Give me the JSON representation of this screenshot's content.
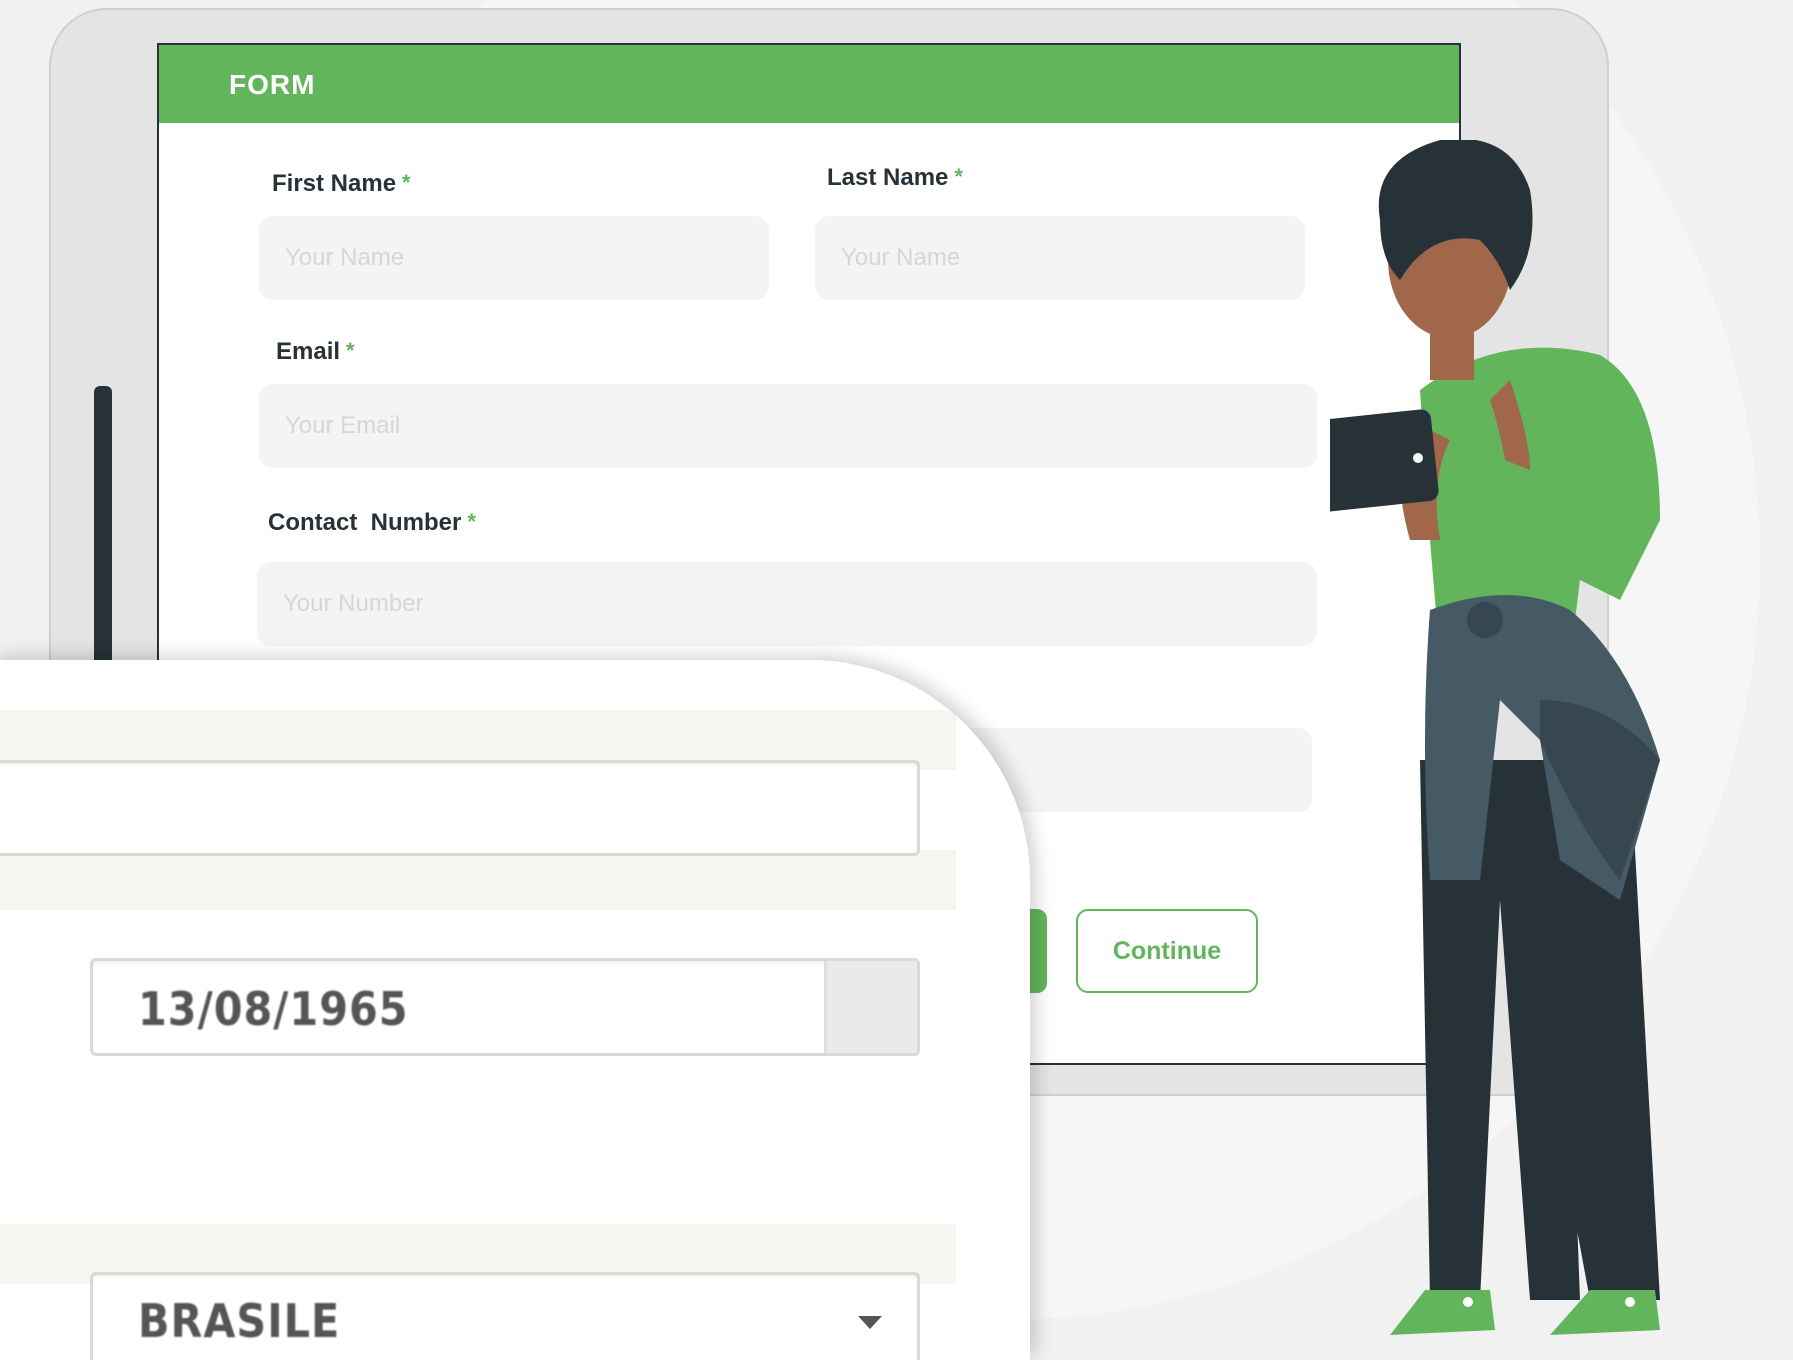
{
  "form": {
    "title": "FORM",
    "required_mark": "*",
    "first_name": {
      "label": "First Name",
      "placeholder": "Your Name"
    },
    "last_name": {
      "label": "Last Name",
      "placeholder": "Your Name"
    },
    "email": {
      "label": "Email",
      "placeholder": "Your Email"
    },
    "contact_number": {
      "label": "Contact  Number",
      "placeholder": "Your Number"
    },
    "continue_label": "Continue"
  },
  "zoom": {
    "date_value": "13/08/1965",
    "country_value": "BRASILE"
  },
  "colors": {
    "accent": "#63b55c",
    "dark": "#263238",
    "field_bg": "#f4f4f4"
  }
}
